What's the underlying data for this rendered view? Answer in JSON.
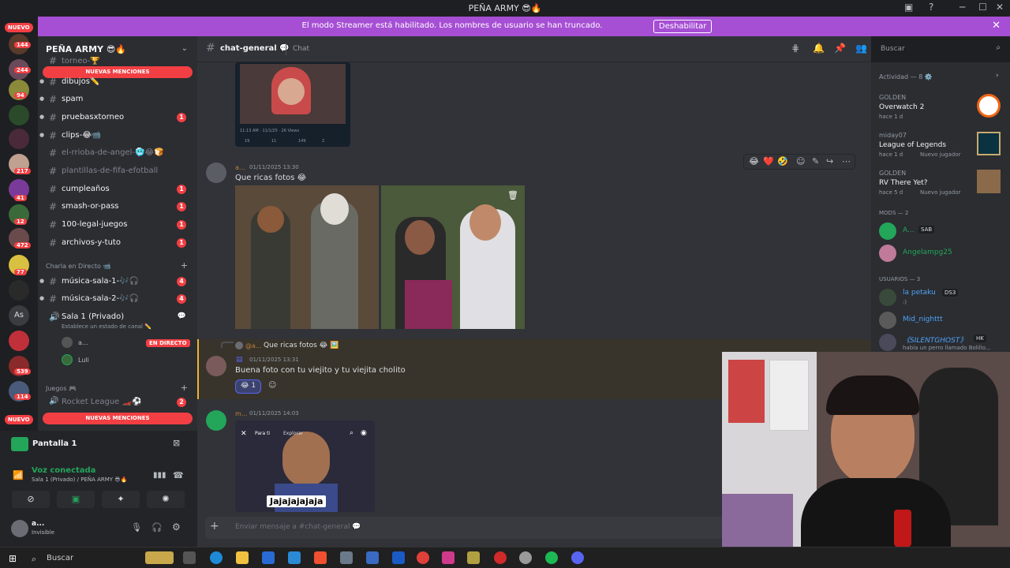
{
  "window": {
    "title": "PEÑA ARMY 😎🔥",
    "controls": [
      "─",
      "☐",
      "✕"
    ]
  },
  "banner": {
    "text": "El modo Streamer está habilitado. Los nombres de usuario se han truncado.",
    "disable_label": "Deshabilitar",
    "close": "✕"
  },
  "rail": {
    "badges": [
      "144",
      "244",
      "94",
      "217",
      "41",
      "12",
      "472",
      "77",
      "539",
      "114"
    ],
    "nuevo": "NUEVO",
    "as_label": "As"
  },
  "sidebar": {
    "server_name": "PEÑA ARMY 😎🔥",
    "new_mentions": "NUEVAS MENCIONES",
    "partial_top": "torneo-🏆",
    "channels": [
      {
        "name": "dibujos✏️",
        "badge": ""
      },
      {
        "name": "spam",
        "badge": ""
      },
      {
        "name": "pruebasxtorneo",
        "badge": "1"
      },
      {
        "name": "clips-😂📹",
        "badge": ""
      },
      {
        "name": "el-rrioba-de-angel-🥶😂🍞",
        "badge": ""
      },
      {
        "name": "plantillas-de-fifa-efotball",
        "badge": ""
      },
      {
        "name": "cumpleaños",
        "badge": "1"
      },
      {
        "name": "smash-or-pass",
        "badge": "1"
      },
      {
        "name": "100-legal-juegos",
        "badge": "1"
      },
      {
        "name": "archivos-y-tuto",
        "badge": "1"
      }
    ],
    "cat_live": "Charla en Directo 📹",
    "voice_channels": [
      {
        "name": "música-sala-1-🎶🎧",
        "badge": "4"
      },
      {
        "name": "música-sala-2-🎶🎧",
        "badge": "4"
      }
    ],
    "room": {
      "name": "Sala 1 (Privado)",
      "status": "Establece un estado de canal ✏️",
      "users": [
        {
          "name": "a...",
          "tag": "EN DIRECTO"
        },
        {
          "name": "Luli",
          "tag": ""
        }
      ]
    },
    "cat_games": "Juegos 🎮",
    "rocket": {
      "name": "Rocket League 🏎️⚽",
      "badge": "2"
    }
  },
  "userpanel": {
    "screen": "Pantalla 1",
    "voice_status": "Voz conectada",
    "voice_where": "Sala 1 (Privado) / PEÑA ARMY 😎🔥",
    "user": "a...",
    "user_status": "Invisible"
  },
  "chatheader": {
    "channel": "chat-general 💬",
    "tab": "Chat"
  },
  "chat": {
    "tweet_ts": "11:13 AM · 11/1/25 · 2K Views",
    "tweet_stats": [
      "19",
      "11",
      "149",
      "2"
    ],
    "msg1": {
      "user": "a...",
      "ts": "01/11/2025 13:30",
      "text": "Que ricas fotos 😂"
    },
    "reactions_bar": [
      "😂",
      "❤️",
      "🤣"
    ],
    "msg2": {
      "reply_user": "@a...",
      "reply_text": "Que ricas fotos 😂 🖼️",
      "ts": "01/11/2025 13:31",
      "text": "Buena foto con tu viejito y tu viejita cholito",
      "reaction": "😂 1"
    },
    "msg3": {
      "user": "m...",
      "ts": "01/11/2025 14:03",
      "video_tabs": [
        "Para ti",
        "Explorar"
      ],
      "video_caption": "Jajajajajaja"
    },
    "composer_placeholder": "Enviar mensaje a #chat-general 💬"
  },
  "members": {
    "search_placeholder": "Buscar",
    "activity_title": "Actividad — 8 ⚙️",
    "activities": [
      {
        "user": "GOLDEN",
        "game": "Overwatch 2",
        "ago": "hace 1 d",
        "extra": ""
      },
      {
        "user": "miday07",
        "game": "League of Legends",
        "ago": "hace 1 d",
        "extra": "Nuevo jugador"
      },
      {
        "user": "GOLDEN",
        "game": "RV There Yet?",
        "ago": "hace 5 d",
        "extra": "Nuevo jugador"
      }
    ],
    "mods_title": "MODS — 2",
    "mods": [
      {
        "name": "A...",
        "tag": "SAB"
      },
      {
        "name": "Angelampg25",
        "tag": ""
      }
    ],
    "users_title": "USUARIOS — 3",
    "users": [
      {
        "name": "la petaku",
        "tag": "DS3",
        "sub": ":)"
      },
      {
        "name": "Mid_nighttt",
        "tag": "",
        "sub": ""
      },
      {
        "name": "《SILENTGHOST》",
        "tag": "HK",
        "sub": "había un perro llamado Bolillo..."
      }
    ]
  },
  "taskbar": {
    "search": "Buscar"
  }
}
